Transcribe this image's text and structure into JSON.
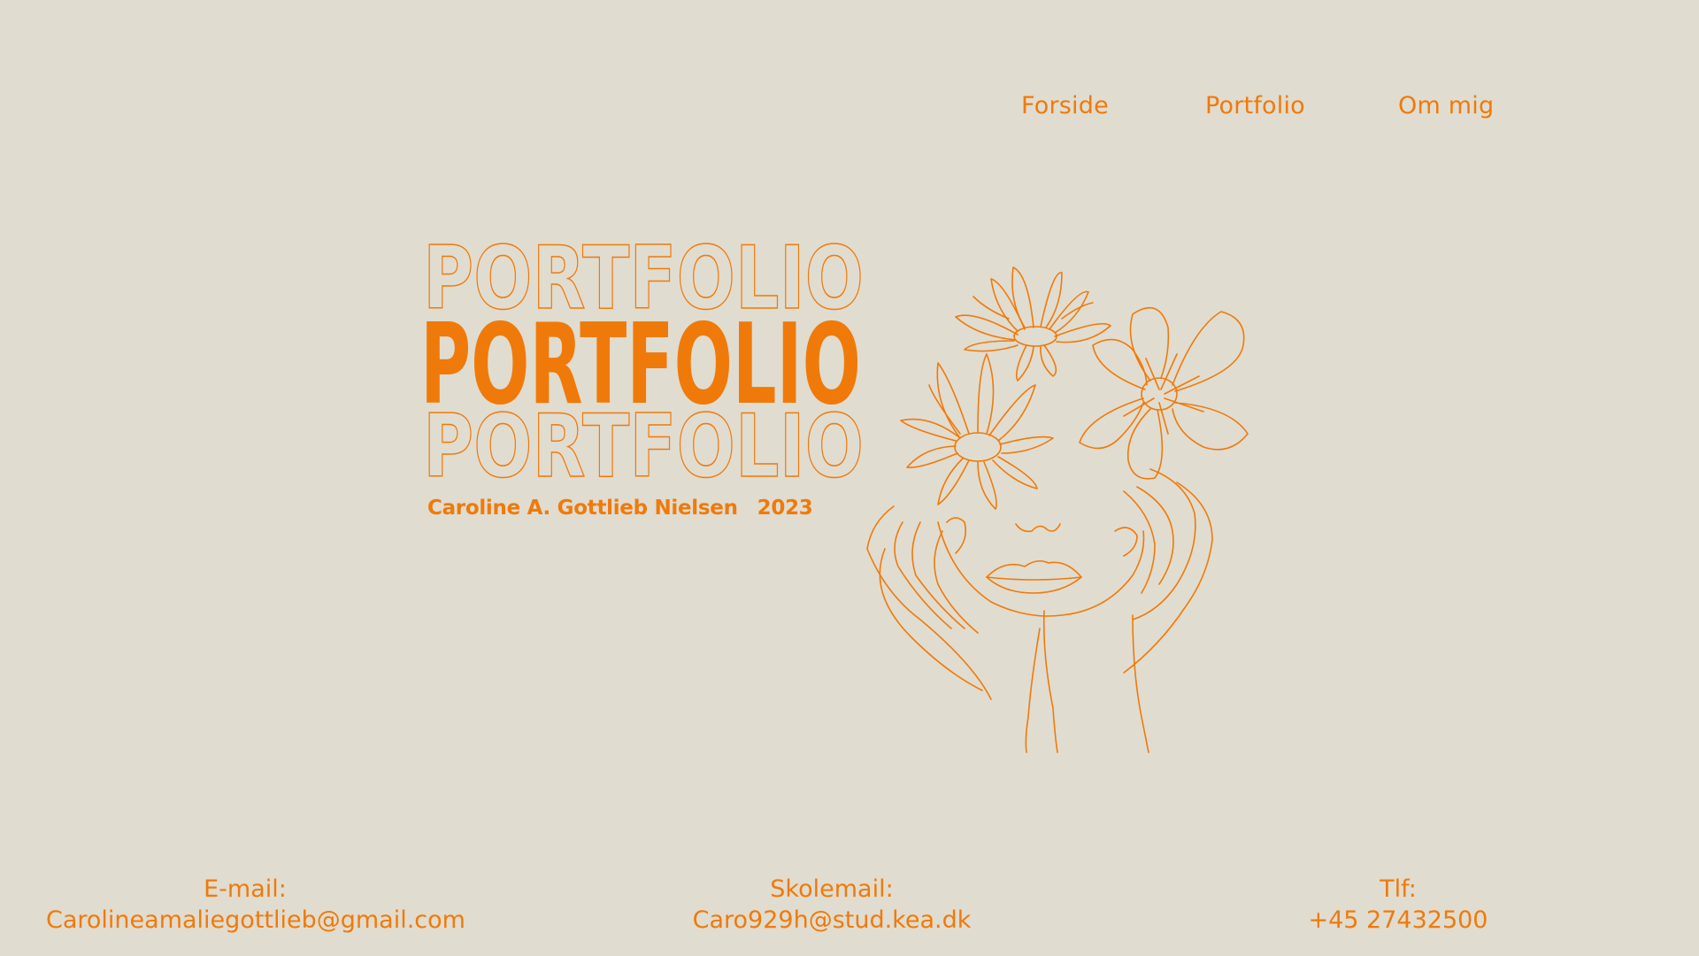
{
  "nav": {
    "items": [
      {
        "label": "Forside"
      },
      {
        "label": "Portfolio"
      },
      {
        "label": "Om mig"
      }
    ]
  },
  "hero": {
    "title": "PORTFOLIO",
    "author": "Caroline A. Gottlieb Nielsen",
    "year": "2023"
  },
  "contact": {
    "email": {
      "label": "E-mail:",
      "value": "Carolineamaliegottlieb@gmail.com"
    },
    "school_email": {
      "label": "Skolemail:",
      "value": "Caro929h@stud.kea.dk"
    },
    "phone": {
      "label": "Tlf:",
      "value": "+45 27432500"
    }
  },
  "colors": {
    "background": "#e0dcd0",
    "accent": "#f07a09"
  },
  "illustration": {
    "icon": "woman-with-flowers-line-art"
  }
}
